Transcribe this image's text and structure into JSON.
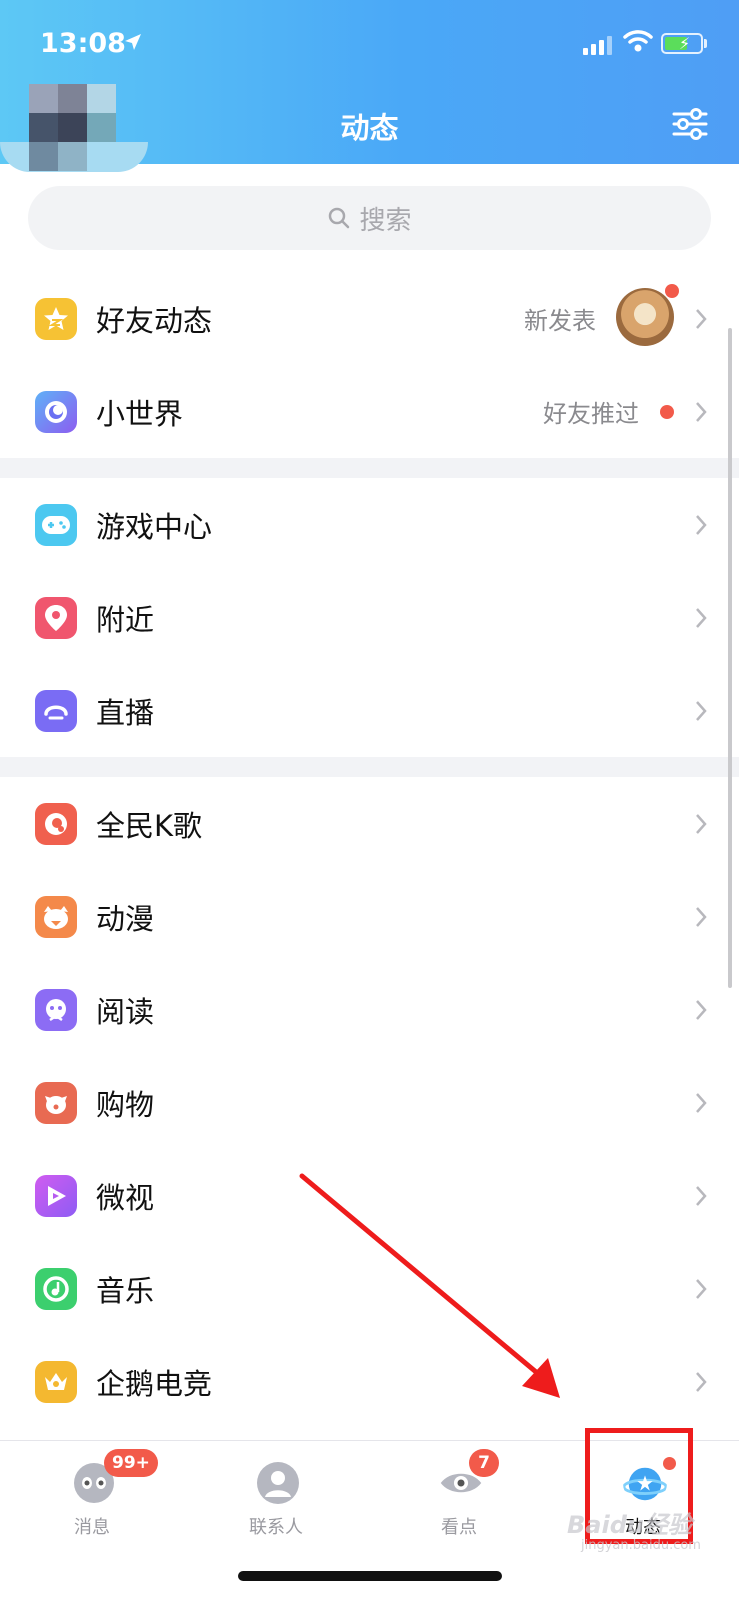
{
  "status_bar": {
    "time": "13:08"
  },
  "header": {
    "title": "动态"
  },
  "search": {
    "placeholder": "搜索"
  },
  "groups": [
    {
      "items": [
        {
          "label": "好友动态",
          "sub": "新发表",
          "icon": "star-square-icon",
          "color": "#f6c234",
          "has_avatar": true,
          "has_dot": true
        },
        {
          "label": "小世界",
          "sub": "好友推过",
          "icon": "planet-eye-icon",
          "color": "#7a6cf4",
          "has_dot": true
        }
      ]
    },
    {
      "items": [
        {
          "label": "游戏中心",
          "icon": "gamepad-icon",
          "color": "#4cc8f0"
        },
        {
          "label": "附近",
          "icon": "location-pin-icon",
          "color": "#f0566e"
        },
        {
          "label": "直播",
          "icon": "live-icon",
          "color": "#7a6cf4"
        }
      ]
    },
    {
      "items": [
        {
          "label": "全民K歌",
          "icon": "karaoke-icon",
          "color": "#f0604e"
        },
        {
          "label": "动漫",
          "icon": "anime-icon",
          "color": "#f4894a"
        },
        {
          "label": "阅读",
          "icon": "reading-icon",
          "color": "#8c6cf4"
        },
        {
          "label": "购物",
          "icon": "shopping-dog-icon",
          "color": "#e86a52"
        },
        {
          "label": "微视",
          "icon": "weishi-play-icon",
          "color": "#b65cf0"
        },
        {
          "label": "音乐",
          "icon": "music-icon",
          "color": "#3ccf6e"
        },
        {
          "label": "企鹅电竞",
          "icon": "esports-crown-icon",
          "color": "#f4b830"
        }
      ]
    }
  ],
  "tabs": [
    {
      "label": "消息",
      "icon": "message-penguin-icon",
      "badge": "99+"
    },
    {
      "label": "联系人",
      "icon": "contacts-person-icon"
    },
    {
      "label": "看点",
      "icon": "eye-icon",
      "badge": "7"
    },
    {
      "label": "动态",
      "icon": "planet-icon",
      "active": true
    }
  ],
  "watermark": {
    "text": "Baidu经验",
    "sub": "jingyan.baidu.com"
  },
  "colors": {
    "header_start": "#5dc8f5",
    "header_end": "#4f9ef5",
    "accent_red": "#f25a4a",
    "annotation": "#ee1c1c"
  }
}
